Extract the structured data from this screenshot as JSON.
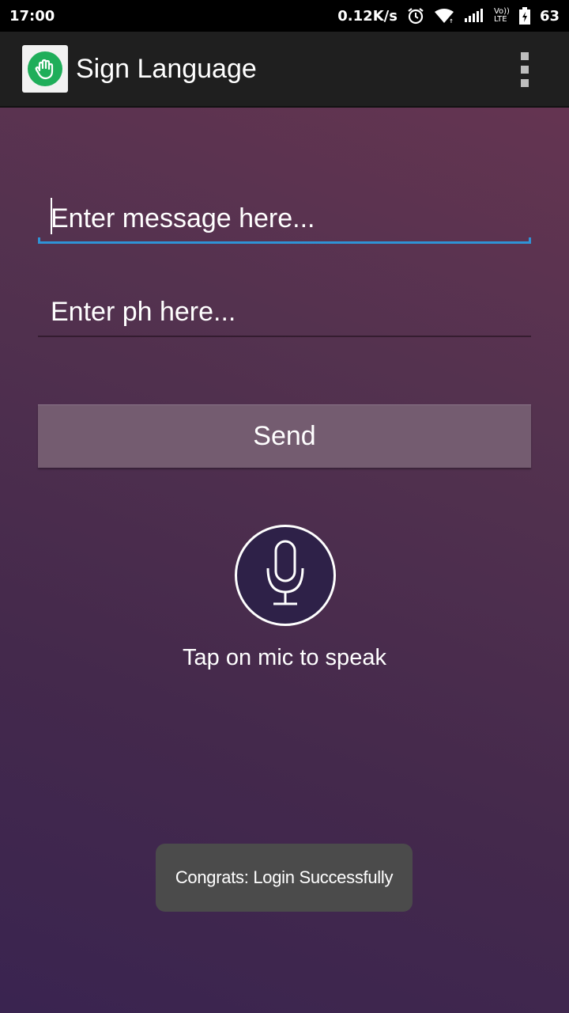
{
  "status_bar": {
    "time": "17:00",
    "network_speed": "0.12K/s",
    "volte_top": "Vo))",
    "volte_bottom": "LTE",
    "battery_level": "63",
    "icons": [
      "alarm-icon",
      "wifi-icon",
      "signal-icon",
      "volte-icon",
      "battery-icon"
    ]
  },
  "app_bar": {
    "title": "Sign Language",
    "icon": "hand-logo-icon",
    "menu_icon": "overflow-menu-icon"
  },
  "form": {
    "message_placeholder": "Enter message here...",
    "message_value": "",
    "phone_placeholder": "Enter ph here...",
    "phone_value": "",
    "send_label": "Send"
  },
  "mic": {
    "icon": "microphone-icon",
    "hint": "Tap on mic to speak"
  },
  "toast": {
    "text": "Congrats: Login Successfully"
  },
  "colors": {
    "accent": "#2f93d6",
    "logo_green": "#1fae5a",
    "button": "#745c70",
    "mic_fill": "#2e2148"
  }
}
